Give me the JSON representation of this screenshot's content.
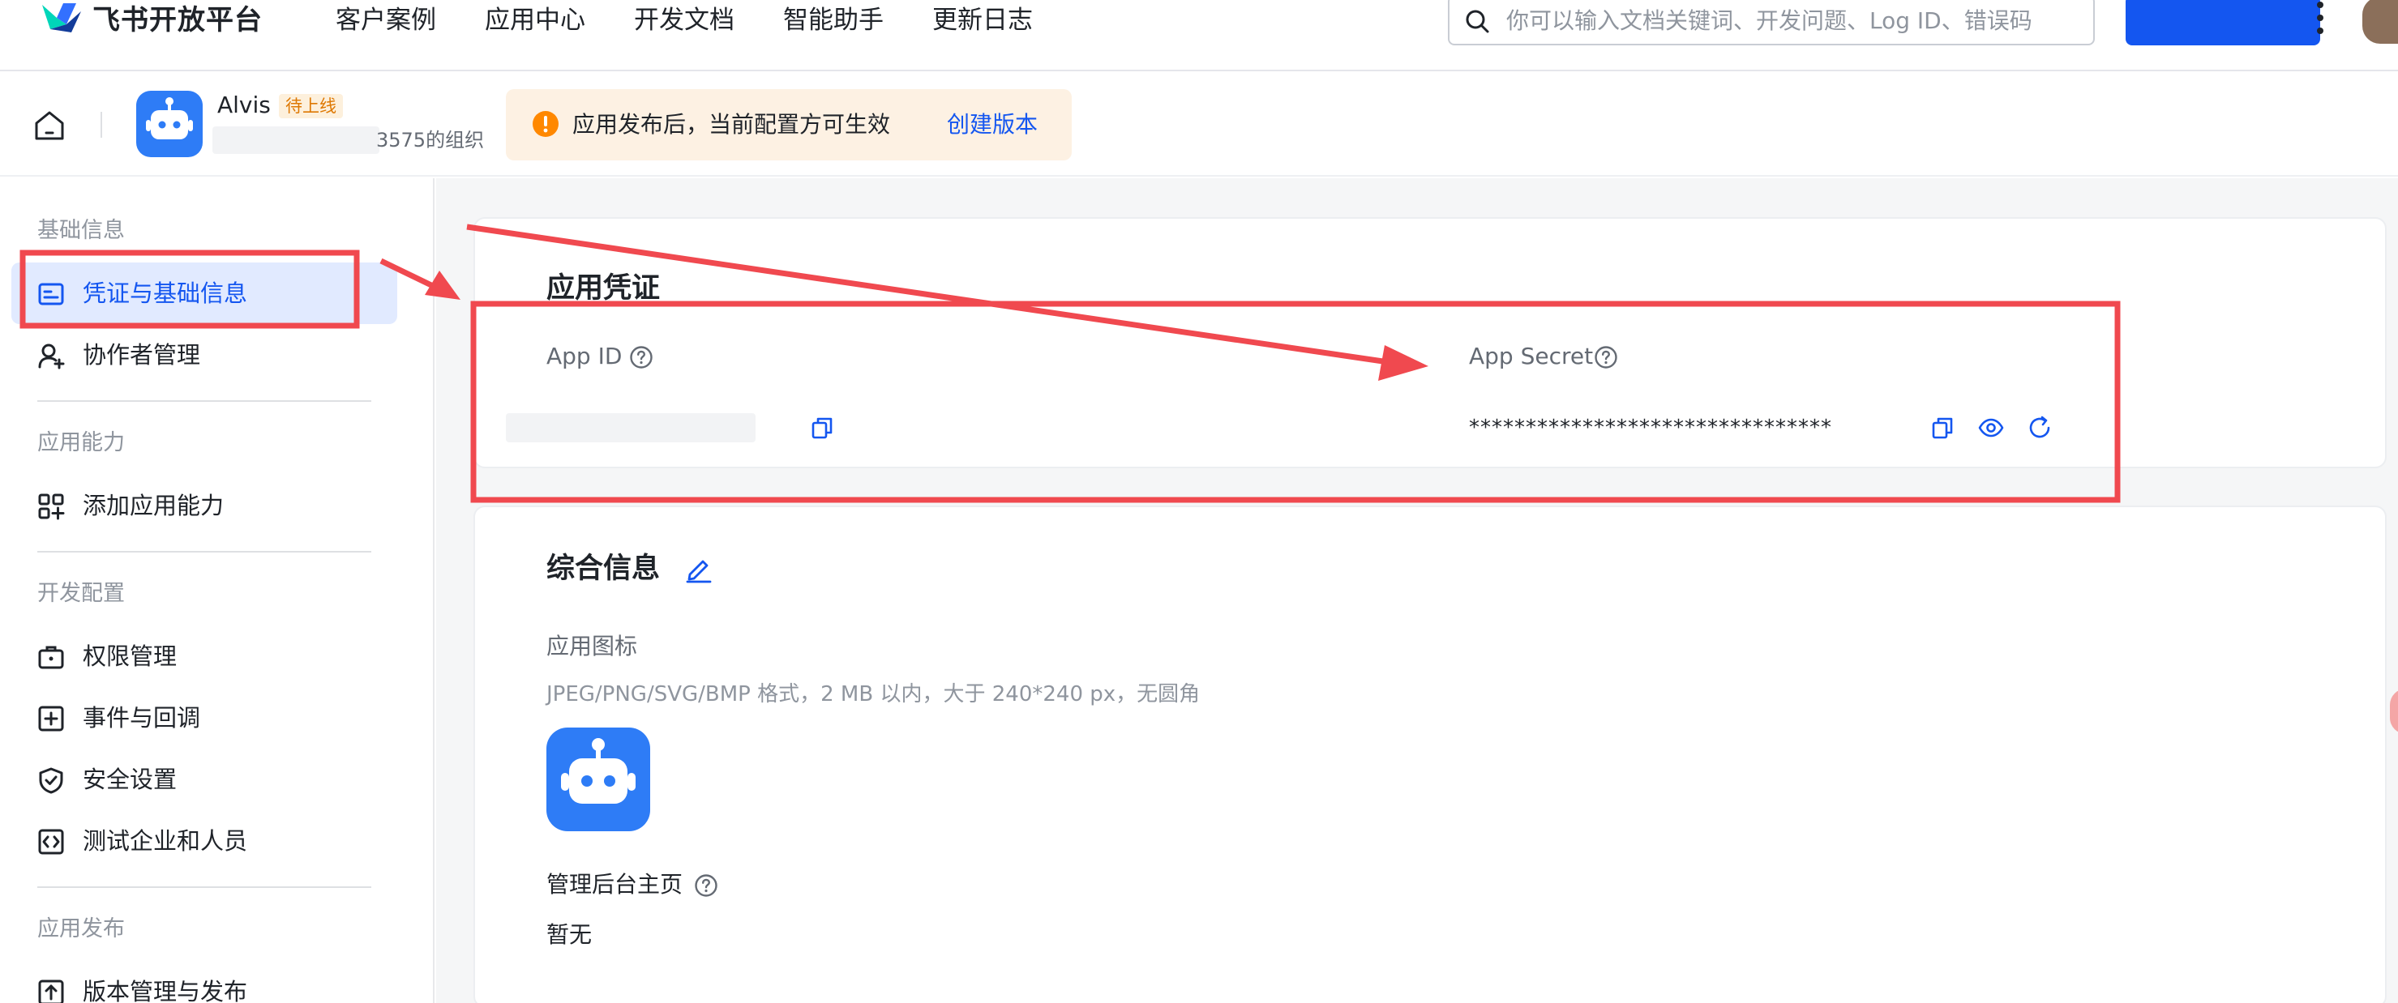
{
  "topnav": {
    "brand": "飞书开放平台",
    "links": [
      "客户案例",
      "应用中心",
      "开发文档",
      "智能助手",
      "更新日志"
    ],
    "search_placeholder": "你可以输入文档关键词、开发问题、Log ID、错误码"
  },
  "app": {
    "name": "Alvis",
    "badge": "待上线",
    "org": "3575的组织"
  },
  "notice": {
    "text": "应用发布后，当前配置方可生效",
    "link": "创建版本"
  },
  "sidebar": {
    "groups": [
      {
        "title": "基础信息",
        "items": [
          {
            "label": "凭证与基础信息",
            "icon": "credential-icon",
            "active": true
          },
          {
            "label": "协作者管理",
            "icon": "user-add-icon"
          }
        ]
      },
      {
        "title": "应用能力",
        "items": [
          {
            "label": "添加应用能力",
            "icon": "apps-add-icon"
          }
        ]
      },
      {
        "title": "开发配置",
        "items": [
          {
            "label": "权限管理",
            "icon": "briefcase-icon"
          },
          {
            "label": "事件与回调",
            "icon": "plus-box-icon"
          },
          {
            "label": "安全设置",
            "icon": "shield-icon"
          },
          {
            "label": "测试企业和人员",
            "icon": "code-box-icon"
          }
        ]
      },
      {
        "title": "应用发布",
        "items": [
          {
            "label": "版本管理与发布",
            "icon": "upload-box-icon"
          }
        ]
      }
    ]
  },
  "credentials": {
    "title": "应用凭证",
    "app_id_label": "App ID",
    "app_secret_label": "App Secret",
    "app_secret_value": "********************************"
  },
  "info": {
    "title": "综合信息",
    "icon_label": "应用图标",
    "icon_hint": "JPEG/PNG/SVG/BMP 格式，2 MB 以内，大于 240*240 px，无圆角",
    "homepage_label": "管理后台主页",
    "homepage_value": "暂无"
  },
  "colors": {
    "primary": "#1456f0",
    "annotation": "#f0494f",
    "active_bg": "#e1eaff",
    "notice_bg": "#fdf1e3"
  }
}
